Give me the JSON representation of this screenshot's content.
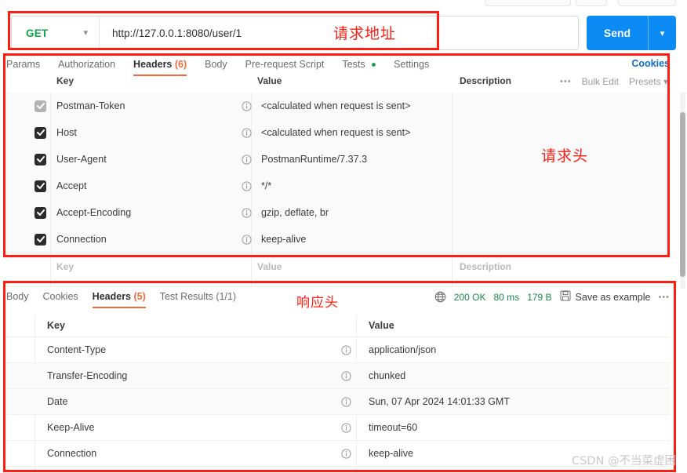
{
  "request_bar": {
    "method": "GET",
    "method_caret": "chevron-down",
    "url": "http://127.0.0.1:8080/user/1",
    "send_label": "Send",
    "send_caret": "chevron-down"
  },
  "request_tabs": {
    "items": [
      {
        "label": "Params",
        "active": false
      },
      {
        "label": "Authorization",
        "active": false
      },
      {
        "label": "Headers",
        "count": "(6)",
        "active": true
      },
      {
        "label": "Body",
        "active": false
      },
      {
        "label": "Pre-request Script",
        "active": false
      },
      {
        "label": "Tests",
        "dot": true,
        "active": false
      },
      {
        "label": "Settings",
        "active": false
      }
    ],
    "cookies_link": "Cookies"
  },
  "request_table": {
    "columns": {
      "key": "Key",
      "value": "Value",
      "description": "Description"
    },
    "tools": {
      "more": "•••",
      "bulk_edit": "Bulk Edit",
      "presets": "Presets"
    },
    "rows": [
      {
        "checked": true,
        "disabled": true,
        "key": "Postman-Token",
        "value": "<calculated when request is sent>"
      },
      {
        "checked": true,
        "disabled": false,
        "key": "Host",
        "value": "<calculated when request is sent>"
      },
      {
        "checked": true,
        "disabled": false,
        "key": "User-Agent",
        "value": "PostmanRuntime/7.37.3"
      },
      {
        "checked": true,
        "disabled": false,
        "key": "Accept",
        "value": "*/*"
      },
      {
        "checked": true,
        "disabled": false,
        "key": "Accept-Encoding",
        "value": "gzip, deflate, br"
      },
      {
        "checked": true,
        "disabled": false,
        "key": "Connection",
        "value": "keep-alive"
      }
    ],
    "placeholder_row": {
      "key": "Key",
      "value": "Value",
      "description": "Description"
    }
  },
  "response_tabs": {
    "items": [
      {
        "label": "Body",
        "active": false
      },
      {
        "label": "Cookies",
        "active": false
      },
      {
        "label": "Headers",
        "count": "(5)",
        "active": true
      },
      {
        "label": "Test Results",
        "count": "(1/1)",
        "active": false
      }
    ]
  },
  "response_status": {
    "globe_icon": "globe-icon",
    "status": "200 OK",
    "time": "80 ms",
    "size": "179 B",
    "save_icon": "save-icon",
    "save_as_example": "Save as example",
    "more": "•••"
  },
  "response_table": {
    "columns": {
      "key": "Key",
      "value": "Value"
    },
    "rows": [
      {
        "key": "Content-Type",
        "value": "application/json"
      },
      {
        "key": "Transfer-Encoding",
        "value": "chunked"
      },
      {
        "key": "Date",
        "value": "Sun, 07 Apr 2024 14:01:33 GMT"
      },
      {
        "key": "Keep-Alive",
        "value": "timeout=60"
      },
      {
        "key": "Connection",
        "value": "keep-alive"
      }
    ]
  },
  "annotations": {
    "color": "#fd1d12",
    "url_label": "请求地址",
    "request_headers_label": "请求头",
    "response_headers_label": "响应头"
  },
  "watermark": "CSDN @不当菜虚困",
  "colors": {
    "method_green": "#10a54a",
    "send_blue": "#0d8bf5",
    "accent_orange": "#f26b3a",
    "link_blue": "#0b6ed1",
    "status_green": "#1a8a4b",
    "annotation_red": "#fd1d12"
  }
}
